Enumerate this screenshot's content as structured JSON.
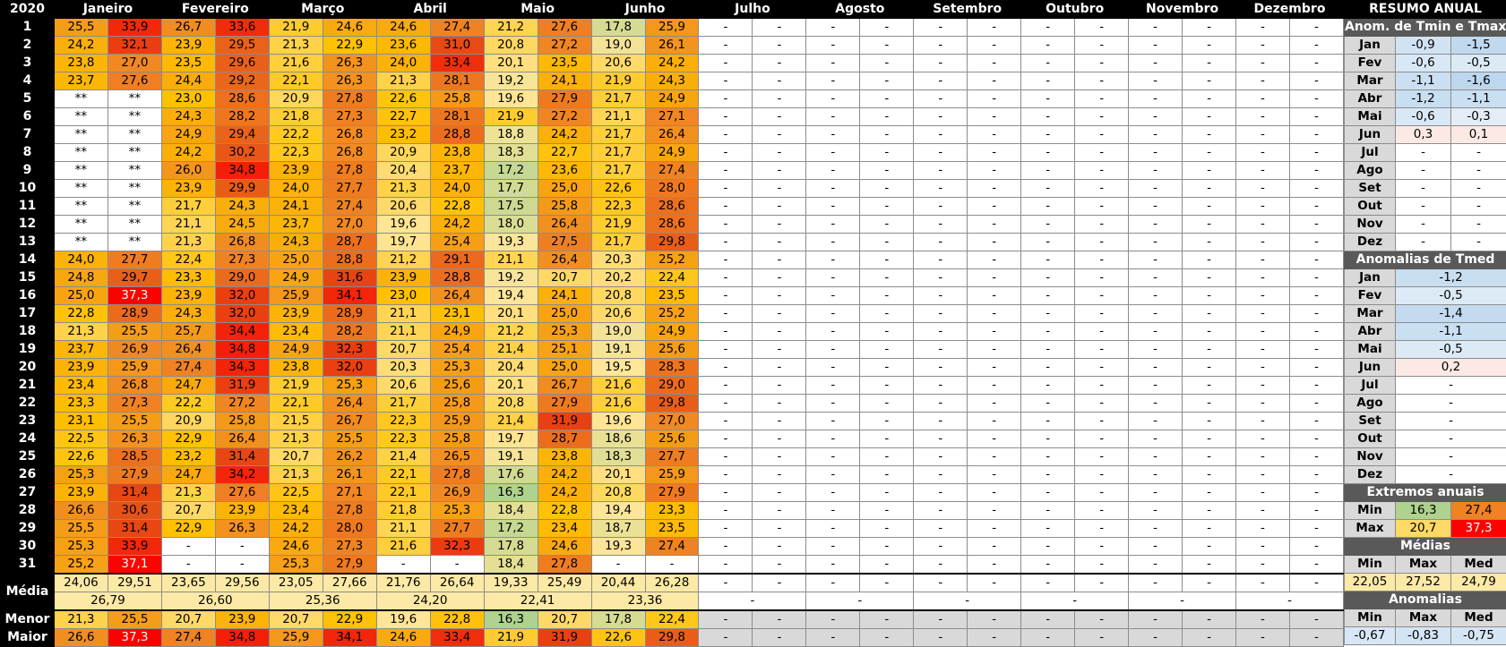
{
  "year": "2020",
  "months": [
    "Janeiro",
    "Fevereiro",
    "Março",
    "Abril",
    "Maio",
    "Junho",
    "Julho",
    "Agosto",
    "Setembro",
    "Outubro",
    "Novembro",
    "Dezembro"
  ],
  "rows": [
    [
      "25,5",
      "33,9",
      "26,7",
      "33,6",
      "21,9",
      "24,6",
      "24,6",
      "27,4",
      "21,2",
      "27,6",
      "17,8",
      "25,9"
    ],
    [
      "24,2",
      "32,1",
      "23,9",
      "29,5",
      "21,3",
      "22,9",
      "23,6",
      "31,0",
      "20,8",
      "27,2",
      "19,0",
      "26,1"
    ],
    [
      "23,8",
      "27,0",
      "23,5",
      "29,6",
      "21,6",
      "26,3",
      "24,0",
      "33,4",
      "20,1",
      "23,5",
      "20,6",
      "24,2"
    ],
    [
      "23,7",
      "27,6",
      "24,4",
      "29,2",
      "22,1",
      "26,3",
      "21,3",
      "28,1",
      "19,2",
      "24,1",
      "21,9",
      "24,3"
    ],
    [
      "**",
      "**",
      "23,0",
      "28,6",
      "20,9",
      "27,8",
      "22,6",
      "25,8",
      "19,6",
      "27,9",
      "21,7",
      "24,9"
    ],
    [
      "**",
      "**",
      "24,3",
      "28,2",
      "21,8",
      "27,3",
      "22,7",
      "28,1",
      "21,9",
      "27,2",
      "21,1",
      "27,1"
    ],
    [
      "**",
      "**",
      "24,9",
      "29,4",
      "22,2",
      "26,8",
      "23,2",
      "28,8",
      "18,8",
      "24,2",
      "21,7",
      "26,4"
    ],
    [
      "**",
      "**",
      "24,2",
      "30,2",
      "22,3",
      "26,8",
      "20,9",
      "23,8",
      "18,3",
      "22,7",
      "21,7",
      "24,9"
    ],
    [
      "**",
      "**",
      "26,0",
      "34,8",
      "23,9",
      "27,8",
      "20,4",
      "23,7",
      "17,2",
      "23,6",
      "21,7",
      "27,4"
    ],
    [
      "**",
      "**",
      "23,9",
      "29,9",
      "24,0",
      "27,7",
      "21,3",
      "24,0",
      "17,7",
      "25,0",
      "22,6",
      "28,0"
    ],
    [
      "**",
      "**",
      "21,7",
      "24,3",
      "24,1",
      "27,4",
      "20,6",
      "22,8",
      "17,5",
      "25,8",
      "22,3",
      "28,6"
    ],
    [
      "**",
      "**",
      "21,1",
      "24,5",
      "23,7",
      "27,0",
      "19,6",
      "24,2",
      "18,0",
      "26,4",
      "21,9",
      "28,6"
    ],
    [
      "**",
      "**",
      "21,3",
      "26,8",
      "24,3",
      "28,7",
      "19,7",
      "25,4",
      "19,3",
      "27,5",
      "21,7",
      "29,8"
    ],
    [
      "24,0",
      "27,7",
      "22,4",
      "27,3",
      "25,0",
      "28,8",
      "21,2",
      "29,1",
      "21,1",
      "26,4",
      "20,3",
      "25,2"
    ],
    [
      "24,8",
      "29,7",
      "23,3",
      "29,0",
      "24,9",
      "31,6",
      "23,9",
      "28,8",
      "19,2",
      "20,7",
      "20,2",
      "22,4"
    ],
    [
      "25,0",
      "37,3",
      "23,9",
      "32,0",
      "25,9",
      "34,1",
      "23,0",
      "26,4",
      "19,4",
      "24,1",
      "20,8",
      "23,5"
    ],
    [
      "22,8",
      "28,9",
      "24,3",
      "32,0",
      "23,9",
      "28,9",
      "21,1",
      "23,1",
      "20,1",
      "25,0",
      "20,6",
      "25,2"
    ],
    [
      "21,3",
      "25,5",
      "25,7",
      "34,4",
      "23,4",
      "28,2",
      "21,1",
      "24,9",
      "21,2",
      "25,3",
      "19,0",
      "24,9"
    ],
    [
      "23,7",
      "26,9",
      "26,4",
      "34,8",
      "24,9",
      "32,3",
      "20,7",
      "25,4",
      "21,4",
      "25,1",
      "19,1",
      "25,6"
    ],
    [
      "23,9",
      "25,9",
      "27,4",
      "34,3",
      "23,8",
      "32,0",
      "20,3",
      "25,3",
      "20,4",
      "25,0",
      "19,5",
      "28,3"
    ],
    [
      "23,4",
      "26,8",
      "24,7",
      "31,9",
      "21,9",
      "25,3",
      "20,6",
      "25,6",
      "20,1",
      "26,7",
      "21,6",
      "29,0"
    ],
    [
      "23,3",
      "27,3",
      "22,2",
      "27,2",
      "22,1",
      "26,4",
      "21,7",
      "25,8",
      "20,8",
      "27,9",
      "21,6",
      "29,8"
    ],
    [
      "23,1",
      "25,5",
      "20,9",
      "25,8",
      "21,5",
      "26,7",
      "22,3",
      "25,9",
      "21,4",
      "31,9",
      "19,6",
      "27,0"
    ],
    [
      "22,5",
      "26,3",
      "22,9",
      "26,4",
      "21,3",
      "25,5",
      "22,3",
      "25,8",
      "19,7",
      "28,7",
      "18,6",
      "25,6"
    ],
    [
      "22,6",
      "28,5",
      "23,2",
      "31,4",
      "20,7",
      "26,2",
      "21,4",
      "26,5",
      "19,1",
      "23,8",
      "18,3",
      "27,7"
    ],
    [
      "25,3",
      "27,9",
      "24,7",
      "34,2",
      "21,3",
      "26,1",
      "22,1",
      "27,8",
      "17,6",
      "24,2",
      "20,1",
      "25,9"
    ],
    [
      "23,9",
      "31,4",
      "21,3",
      "27,6",
      "22,5",
      "27,1",
      "22,1",
      "26,9",
      "16,3",
      "24,2",
      "20,8",
      "27,9"
    ],
    [
      "26,6",
      "30,6",
      "20,7",
      "23,9",
      "23,4",
      "27,8",
      "21,8",
      "25,3",
      "18,4",
      "22,8",
      "19,4",
      "23,3"
    ],
    [
      "25,5",
      "31,4",
      "22,9",
      "26,3",
      "24,2",
      "28,0",
      "21,1",
      "27,7",
      "17,2",
      "23,4",
      "18,7",
      "23,5"
    ],
    [
      "25,3",
      "33,9",
      "-",
      "-",
      "24,6",
      "27,3",
      "21,6",
      "32,3",
      "17,8",
      "24,6",
      "19,3",
      "27,4"
    ],
    [
      "25,2",
      "37,1",
      "-",
      "-",
      "25,3",
      "27,9",
      "-",
      "-",
      "18,4",
      "27,8",
      "-",
      "-"
    ]
  ],
  "media_label": "Média",
  "media_minmax": [
    "24,06",
    "29,51",
    "23,65",
    "29,56",
    "23,05",
    "27,66",
    "21,76",
    "26,64",
    "19,33",
    "25,49",
    "20,44",
    "26,28"
  ],
  "media_med": [
    "26,79",
    "26,60",
    "25,36",
    "24,20",
    "22,41",
    "23,36",
    "-",
    "-",
    "-",
    "-",
    "-",
    "-"
  ],
  "menor_label": "Menor",
  "menor": [
    "21,3",
    "25,5",
    "20,7",
    "23,9",
    "20,7",
    "22,9",
    "19,6",
    "22,8",
    "16,3",
    "20,7",
    "17,8",
    "22,4"
  ],
  "maior_label": "Maior",
  "maior": [
    "26,6",
    "37,3",
    "27,4",
    "34,8",
    "25,9",
    "34,1",
    "24,6",
    "33,4",
    "21,9",
    "31,9",
    "22,6",
    "29,8"
  ],
  "dash": "-",
  "summary": {
    "title": "RESUMO ANUAL",
    "anom_title": "Anom. de Tmin e Tmax",
    "months_abbr": [
      "Jan",
      "Fev",
      "Mar",
      "Abr",
      "Mai",
      "Jun",
      "Jul",
      "Ago",
      "Set",
      "Out",
      "Nov",
      "Dez"
    ],
    "anom_min": [
      "-0,9",
      "-0,6",
      "-1,1",
      "-1,2",
      "-0,6",
      "0,3",
      "-",
      "-",
      "-",
      "-",
      "-",
      "-"
    ],
    "anom_max": [
      "-1,5",
      "-0,5",
      "-1,6",
      "-1,1",
      "-0,3",
      "0,1",
      "-",
      "-",
      "-",
      "-",
      "-",
      "-"
    ],
    "tmed_title": "Anomalias de Tmed",
    "anom_med": [
      "-1,2",
      "-0,5",
      "-1,4",
      "-1,1",
      "-0,5",
      "0,2",
      "-",
      "-",
      "-",
      "-",
      "-",
      "-"
    ],
    "ext_title": "Extremos anuais",
    "min_label": "Min",
    "max_label": "Max",
    "med_label": "Med",
    "ext_min": [
      "16,3",
      "27,4"
    ],
    "ext_max": [
      "20,7",
      "37,3"
    ],
    "medias_title": "Médias",
    "medias": [
      "22,05",
      "27,52",
      "24,79"
    ],
    "anomalias_title": "Anomalias",
    "anomalias": [
      "-0,67",
      "-0,83",
      "-0,75"
    ]
  }
}
